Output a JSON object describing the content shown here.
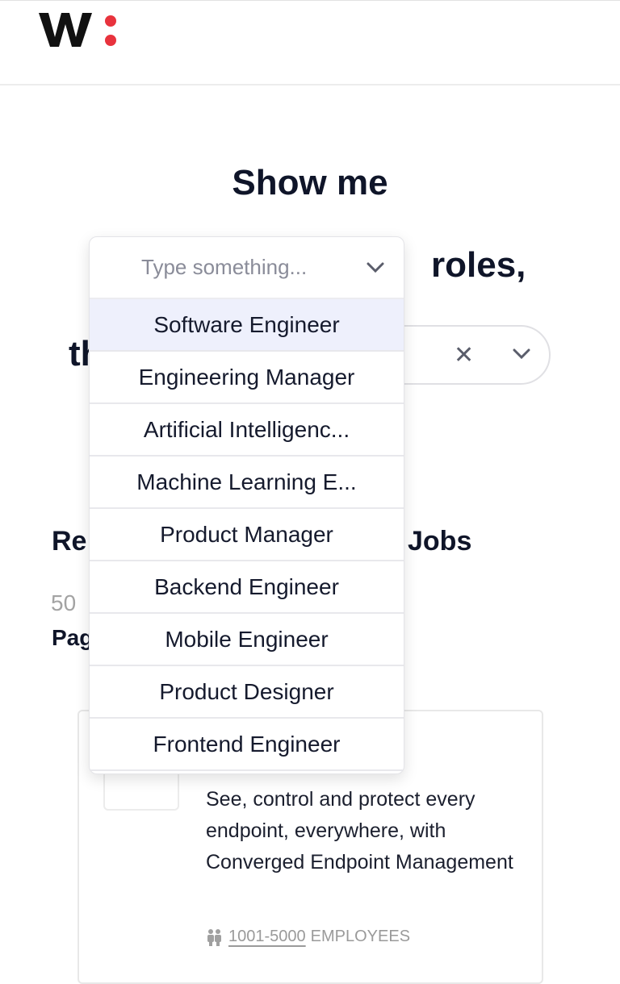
{
  "header": {
    "logo_text": "w:",
    "brand_dot_color": "#e8333d"
  },
  "hero": {
    "line1": "Show me",
    "roles_suffix": "roles,",
    "line3_prefix": "th",
    "location_select": {
      "clear_icon": "close-icon",
      "toggle_icon": "chevron-down-icon"
    }
  },
  "results": {
    "heading_start": "Re",
    "heading_end": "Jobs",
    "count_fragment": "50",
    "page_fragment": "Pag"
  },
  "card": {
    "description": "See, control and protect every endpoint, everywhere, with Converged Endpoint Management",
    "employees_range": "1001-5000",
    "employees_label": "EMPLOYEES"
  },
  "role_dropdown": {
    "placeholder": "Type something...",
    "options": [
      {
        "label": "Software Engineer",
        "highlighted": true
      },
      {
        "label": "Engineering Manager"
      },
      {
        "label": "Artificial Intelligenc..."
      },
      {
        "label": "Machine Learning E..."
      },
      {
        "label": "Product Manager"
      },
      {
        "label": "Backend Engineer"
      },
      {
        "label": "Mobile Engineer"
      },
      {
        "label": "Product Designer"
      },
      {
        "label": "Frontend Engineer"
      }
    ]
  }
}
